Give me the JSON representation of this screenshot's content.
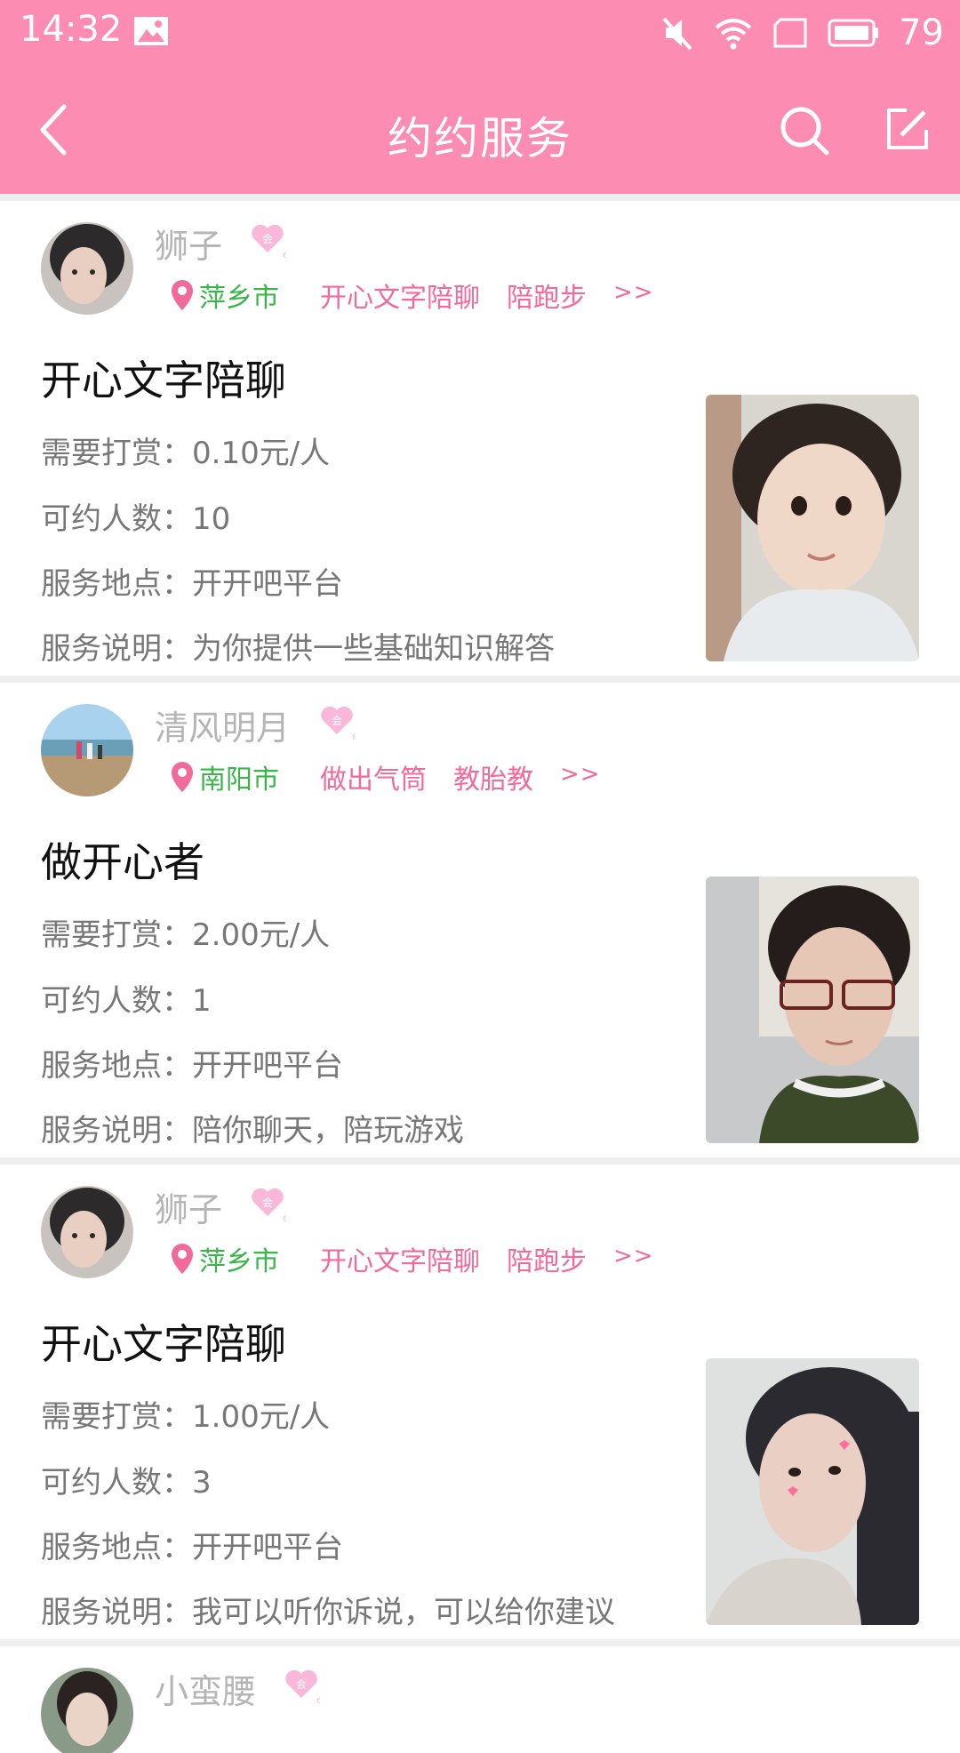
{
  "status_bar": {
    "time": "14:32",
    "battery": "79",
    "icons": [
      "image-icon",
      "mute-icon",
      "wifi-icon",
      "sim-icon",
      "battery-icon"
    ]
  },
  "header": {
    "title": "约约服务",
    "icons": [
      "back-icon",
      "search-icon",
      "edit-icon"
    ],
    "color": "#fd8cb2"
  },
  "labels": {
    "reward": "需要打赏：",
    "count": "可约人数：",
    "place": "服务地点：",
    "desc": "服务说明：",
    "more": ">>"
  },
  "cards": [
    {
      "nickname": "狮子",
      "city": "萍乡市",
      "tags": [
        "开心文字陪聊",
        "陪跑步"
      ],
      "title": "开心文字陪聊",
      "reward": "0.10元/人",
      "count": "10",
      "place": "开开吧平台",
      "desc": "为你提供一些基础知识解答"
    },
    {
      "nickname": "清风明月",
      "city": "南阳市",
      "tags": [
        "做出气筒",
        "教胎教"
      ],
      "title": "做开心者",
      "reward": "2.00元/人",
      "count": "1",
      "place": "开开吧平台",
      "desc": "陪你聊天，陪玩游戏"
    },
    {
      "nickname": "狮子",
      "city": "萍乡市",
      "tags": [
        "开心文字陪聊",
        "陪跑步"
      ],
      "title": "开心文字陪聊",
      "reward": "1.00元/人",
      "count": "3",
      "place": "开开吧平台",
      "desc": "我可以听你诉说，可以给你建议"
    },
    {
      "nickname": "小蛮腰"
    }
  ],
  "colors": {
    "accent": "#fd8cb2",
    "tag": "#f06a9c",
    "city": "#39b54a",
    "muted": "#b5b5b5"
  }
}
